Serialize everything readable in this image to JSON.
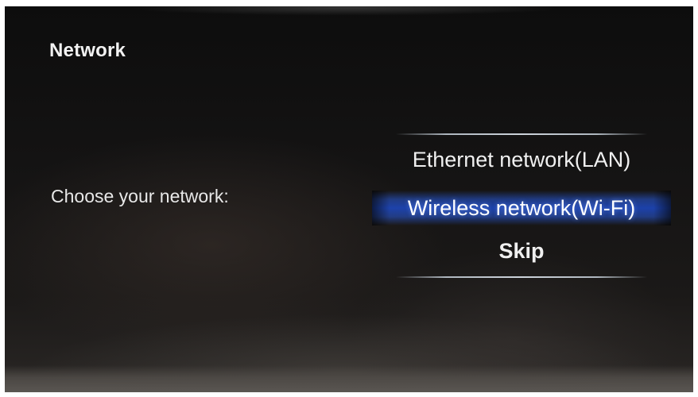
{
  "screen": {
    "title": "Network",
    "prompt": "Choose your network:"
  },
  "menu": {
    "items": [
      {
        "label": "Ethernet network(LAN)",
        "selected": false
      },
      {
        "label": "Wireless network(Wi-Fi)",
        "selected": true
      },
      {
        "label": "Skip",
        "selected": false
      }
    ],
    "highlight_color": "#1e50dc"
  },
  "colors": {
    "background": "#111010",
    "text": "#f0f0f0"
  }
}
